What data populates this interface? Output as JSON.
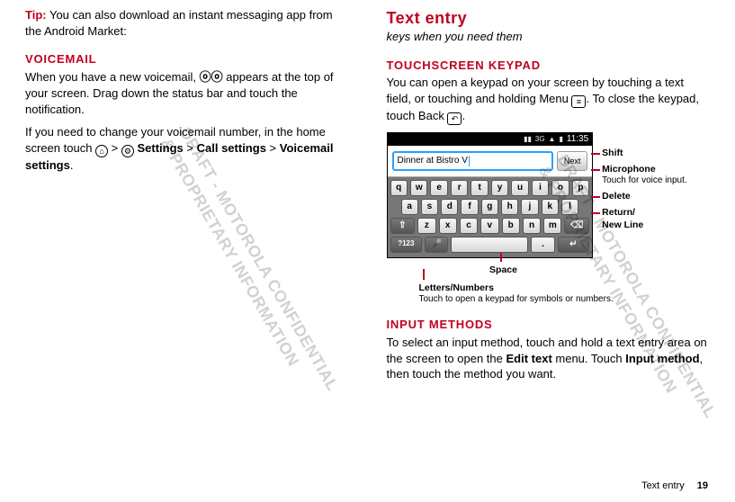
{
  "watermark_left_l1": "DRAFT - MOTOROLA CONFIDENTIAL",
  "watermark_left_l2": "& PROPRIETARY INFORMATION",
  "watermark_right_l1": "DRAFT - MOTOROLA CONFIDENTIAL",
  "watermark_right_l2": "& PROPRIETARY INFORMATION",
  "left": {
    "tip_label": "Tip:",
    "tip_text": " You can also download an instant messaging app from the Android Market:",
    "voicemail_head": "Voicemail",
    "voicemail_p1_a": "When you have a new voicemail, ",
    "voicemail_glyph": "✉",
    "voicemail_p1_b": " appears at the top of your screen. Drag down the status bar and touch the notification.",
    "voicemail_p2_a": "If you need to change your voicemail number, in the home screen touch ",
    "path_sep": " > ",
    "settings_word": "Settings",
    "call_settings": "Call settings",
    "voicemail_settings": "Voicemail settings",
    "period": "."
  },
  "right": {
    "title": "Text entry",
    "subtitle": "keys when you need them",
    "sec1_head": "Touchscreen keypad",
    "sec1_p_a": "You can open a keypad on your screen by touching a text field, or touching and holding Menu ",
    "menu_icon_hint": "≡",
    "sec1_p_b": ". To close the keypad, touch Back ",
    "back_icon_hint": "↶",
    "sec1_p_c": ".",
    "phone": {
      "time": "11:35",
      "input_value": "Dinner at Bistro V",
      "next_btn": "Next",
      "rows": {
        "r1": [
          "q",
          "w",
          "e",
          "r",
          "t",
          "y",
          "u",
          "i",
          "o",
          "p"
        ],
        "r2": [
          "a",
          "s",
          "d",
          "f",
          "g",
          "h",
          "j",
          "k",
          "l"
        ],
        "r3_shift": "⇧",
        "r3": [
          "z",
          "x",
          "c",
          "v",
          "b",
          "n",
          "m"
        ],
        "r3_del": "⌫",
        "r4_sym": "?123",
        "r4_mic": "🎤",
        "r4_space": " ",
        "r4_dot": ".",
        "r4_enter": "↵"
      }
    },
    "callouts": {
      "shift": "Shift",
      "mic_t": "Microphone",
      "mic_s": "Touch for voice input.",
      "delete": "Delete",
      "return_t": "Return/",
      "return_s": "New Line",
      "space": "Space",
      "ln_t": "Letters/Numbers",
      "ln_s": "Touch to open a keypad for symbols or numbers."
    },
    "sec2_head": "Input methods",
    "sec2_p_a": "To select an input method, touch and hold a text entry area on the screen to open the ",
    "edit_text": "Edit text",
    "sec2_p_b": " menu. Touch ",
    "input_method": "Input method",
    "sec2_p_c": ", then touch the method you want."
  },
  "footer": {
    "section": "Text entry",
    "page": "19"
  }
}
